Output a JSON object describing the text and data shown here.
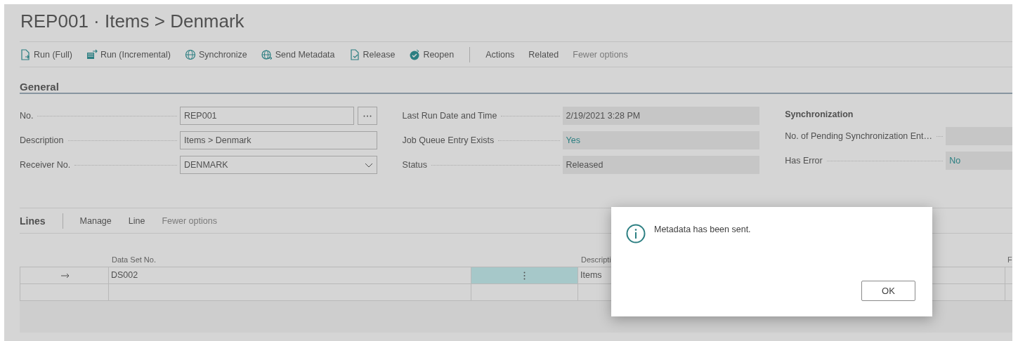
{
  "page": {
    "title": "REP001 · Items > Denmark"
  },
  "actions": [
    {
      "label": "Run (Full)",
      "kind": "run"
    },
    {
      "label": "Run (Incremental)",
      "kind": "incremental"
    },
    {
      "label": "Synchronize",
      "kind": "sync"
    },
    {
      "label": "Send Metadata",
      "kind": "send"
    },
    {
      "label": "Release",
      "kind": "release"
    },
    {
      "label": "Reopen",
      "kind": "reopen"
    }
  ],
  "menus": [
    "Actions",
    "Related",
    "Fewer options"
  ],
  "general": {
    "heading": "General",
    "groups": [
      {
        "fields": [
          {
            "label": "No.",
            "value": "REP001",
            "kind": "lookup"
          },
          {
            "label": "Description",
            "value": "Items > Denmark",
            "kind": "text"
          },
          {
            "label": "Receiver No.",
            "value": "DENMARK",
            "kind": "select"
          }
        ]
      },
      {
        "fields": [
          {
            "label": "Last Run Date and Time",
            "value": "2/19/2021 3:28 PM",
            "kind": "readonly"
          },
          {
            "label": "Job Queue Entry Exists",
            "value": "Yes",
            "kind": "flag"
          },
          {
            "label": "Status",
            "value": "Released",
            "kind": "readonly"
          }
        ]
      },
      {
        "heading": "Synchronization",
        "fields": [
          {
            "label": "No. of Pending Synchronization Ent…",
            "kind": "readonly"
          },
          {
            "label": "Has Error",
            "value": "No",
            "kind": "flag"
          }
        ]
      }
    ]
  },
  "lines": {
    "heading": "Lines",
    "menus": [
      "Manage",
      "Line",
      "Fewer options"
    ],
    "columns": [
      {
        "label": "Data Set No."
      },
      {
        "label": "Descripti"
      },
      {
        "label": "F"
      }
    ],
    "rows": [
      {
        "data_set_no": "DS002",
        "description": "Items",
        "current": true,
        "selected": true
      }
    ]
  },
  "dialog": {
    "message": "Metadata has been sent.",
    "buttons": [
      "OK"
    ]
  }
}
